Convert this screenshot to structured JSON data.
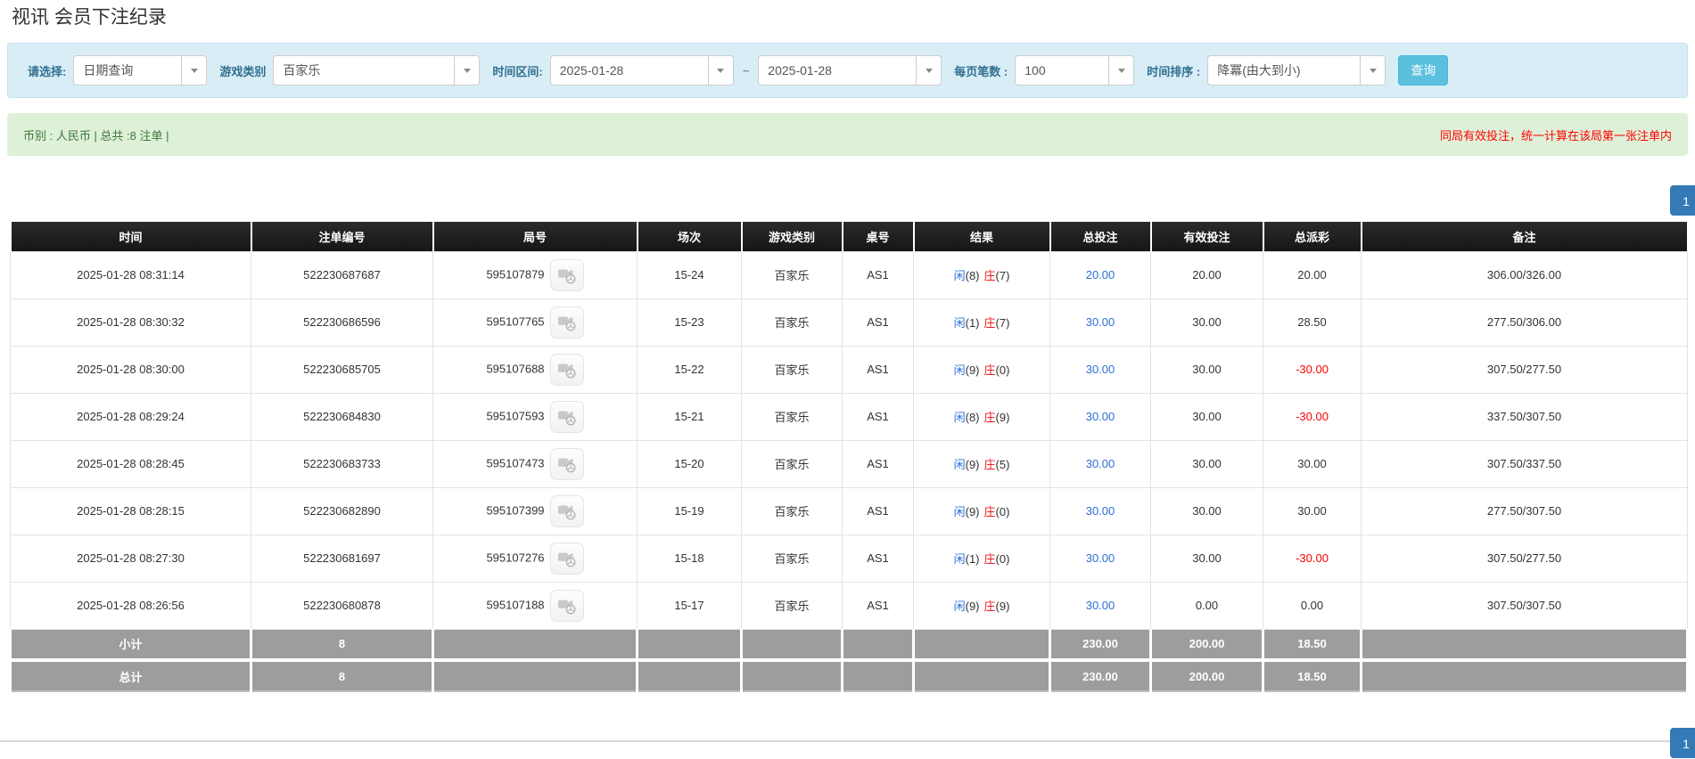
{
  "page": {
    "title": "视讯 会员下注纪录"
  },
  "filters": {
    "select_label": "请选择:",
    "select_value": "日期查询",
    "game_type_label": "游戏类别",
    "game_type_value": "百家乐",
    "date_range_label": "时间区间:",
    "date_from": "2025-01-28",
    "date_separator": "~",
    "date_to": "2025-01-28",
    "page_size_label": "每页笔数 :",
    "page_size_value": "100",
    "sort_label": "时间排序 :",
    "sort_value": "降冪(由大到小)",
    "search_button": "查询"
  },
  "summary_bar": {
    "left_text": "币别 : 人民币 | 总共 :8 注单 |",
    "right_text": "同局有效投注，统一计算在该局第一张注单内"
  },
  "pagination": {
    "page": "1"
  },
  "table": {
    "headers": [
      "时间",
      "注单编号",
      "局号",
      "场次",
      "游戏类别",
      "桌号",
      "结果",
      "总投注",
      "有效投注",
      "总派彩",
      "备注"
    ],
    "rows": [
      {
        "time": "2025-01-28 08:31:14",
        "bet_id": "522230687687",
        "round_id": "595107879",
        "session": "15-24",
        "game": "百家乐",
        "table_no": "AS1",
        "result_player": "闲",
        "result_player_num": "(8)",
        "result_banker": "庄",
        "result_banker_num": "(7)",
        "total_bet": "20.00",
        "valid_bet": "20.00",
        "payout": "20.00",
        "remark": "306.00/326.00"
      },
      {
        "time": "2025-01-28 08:30:32",
        "bet_id": "522230686596",
        "round_id": "595107765",
        "session": "15-23",
        "game": "百家乐",
        "table_no": "AS1",
        "result_player": "闲",
        "result_player_num": "(1)",
        "result_banker": "庄",
        "result_banker_num": "(7)",
        "total_bet": "30.00",
        "valid_bet": "30.00",
        "payout": "28.50",
        "remark": "277.50/306.00"
      },
      {
        "time": "2025-01-28 08:30:00",
        "bet_id": "522230685705",
        "round_id": "595107688",
        "session": "15-22",
        "game": "百家乐",
        "table_no": "AS1",
        "result_player": "闲",
        "result_player_num": "(9)",
        "result_banker": "庄",
        "result_banker_num": "(0)",
        "total_bet": "30.00",
        "valid_bet": "30.00",
        "payout": "-30.00",
        "remark": "307.50/277.50"
      },
      {
        "time": "2025-01-28 08:29:24",
        "bet_id": "522230684830",
        "round_id": "595107593",
        "session": "15-21",
        "game": "百家乐",
        "table_no": "AS1",
        "result_player": "闲",
        "result_player_num": "(8)",
        "result_banker": "庄",
        "result_banker_num": "(9)",
        "total_bet": "30.00",
        "valid_bet": "30.00",
        "payout": "-30.00",
        "remark": "337.50/307.50"
      },
      {
        "time": "2025-01-28 08:28:45",
        "bet_id": "522230683733",
        "round_id": "595107473",
        "session": "15-20",
        "game": "百家乐",
        "table_no": "AS1",
        "result_player": "闲",
        "result_player_num": "(9)",
        "result_banker": "庄",
        "result_banker_num": "(5)",
        "total_bet": "30.00",
        "valid_bet": "30.00",
        "payout": "30.00",
        "remark": "307.50/337.50"
      },
      {
        "time": "2025-01-28 08:28:15",
        "bet_id": "522230682890",
        "round_id": "595107399",
        "session": "15-19",
        "game": "百家乐",
        "table_no": "AS1",
        "result_player": "闲",
        "result_player_num": "(9)",
        "result_banker": "庄",
        "result_banker_num": "(0)",
        "total_bet": "30.00",
        "valid_bet": "30.00",
        "payout": "30.00",
        "remark": "277.50/307.50"
      },
      {
        "time": "2025-01-28 08:27:30",
        "bet_id": "522230681697",
        "round_id": "595107276",
        "session": "15-18",
        "game": "百家乐",
        "table_no": "AS1",
        "result_player": "闲",
        "result_player_num": "(1)",
        "result_banker": "庄",
        "result_banker_num": "(0)",
        "total_bet": "30.00",
        "valid_bet": "30.00",
        "payout": "-30.00",
        "remark": "307.50/277.50"
      },
      {
        "time": "2025-01-28 08:26:56",
        "bet_id": "522230680878",
        "round_id": "595107188",
        "session": "15-17",
        "game": "百家乐",
        "table_no": "AS1",
        "result_player": "闲",
        "result_player_num": "(9)",
        "result_banker": "庄",
        "result_banker_num": "(9)",
        "total_bet": "30.00",
        "valid_bet": "0.00",
        "payout": "0.00",
        "remark": "307.50/307.50"
      }
    ],
    "subtotal": {
      "label": "小计",
      "count": "8",
      "total_bet": "230.00",
      "valid_bet": "200.00",
      "payout": "18.50"
    },
    "total": {
      "label": "总计",
      "count": "8",
      "total_bet": "230.00",
      "valid_bet": "200.00",
      "payout": "18.50"
    }
  },
  "colors": {
    "link_blue": "#2c6fd8",
    "player_blue": "#2c6fd8",
    "banker_red": "#ee1c1c",
    "negative_red": "#ff0000",
    "alert_warning_red": "#ff0000",
    "green_bar_bg": "#dff0d8",
    "green_bar_text": "#3c763d",
    "filter_bar_bg": "#d9edf7",
    "filter_label": "#31708f",
    "search_button_bg": "#5bc0de",
    "table_header_bg": "#1d1d1d",
    "summary_row_bg": "#9d9d9d",
    "pagination_bg": "#337ab7"
  }
}
